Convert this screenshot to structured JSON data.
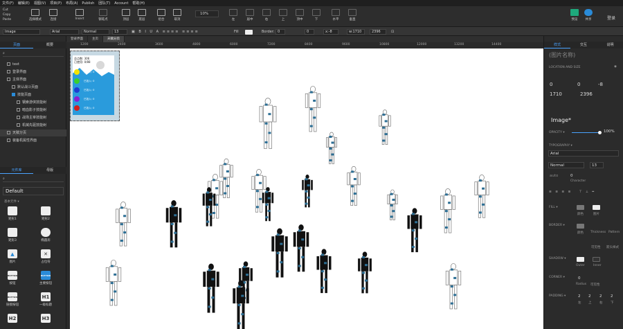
{
  "menu": [
    "文件(F)",
    "编辑(E)",
    "视图(V)",
    "项目(P)",
    "布局(A)",
    "Publish",
    "团队(T)",
    "Account",
    "帮助(H)"
  ],
  "mini_actions": [
    "Cut",
    "Copy",
    "Paste"
  ],
  "toolbar": {
    "select_mode": "选择模式",
    "connect": "连接",
    "insert": "Insert",
    "point": "钢笔点",
    "top": "顶层",
    "bottom": "底层",
    "combine": "组合",
    "uncombine": "取消",
    "zoom": "10%",
    "left": "左",
    "center": "居中",
    "right": "右",
    "up": "上",
    "middle": "顶中",
    "down": "下",
    "horizontal": "水平",
    "vertical": "垂直",
    "preview": "预览",
    "share": "共享",
    "login": "登录"
  },
  "propbar": {
    "type": "Image",
    "font": "Arial",
    "weight": "Normal",
    "size": "13",
    "fill": "Fill",
    "border_label": "Border:",
    "border": "0",
    "border2": "0",
    "x": "x:-8",
    "y": "y:-8",
    "w": "w:1710",
    "h": "2396",
    "ico_auto": "auto"
  },
  "left": {
    "tabs": [
      "页面",
      "概要"
    ],
    "pages": [
      {
        "label": "text",
        "indent": 0
      },
      {
        "label": "登录界面",
        "indent": 0
      },
      {
        "label": "主体界面",
        "indent": 0
      },
      {
        "label": "默认战斗页面",
        "indent": 1
      },
      {
        "label": "技能页面",
        "indent": 1
      },
      {
        "label": "钢索游侠技能树",
        "indent": 2
      },
      {
        "label": "暗血影子技能树",
        "indent": 2
      },
      {
        "label": "战场主宰技能树",
        "indent": 2
      },
      {
        "label": "机械先驱技能树",
        "indent": 2
      },
      {
        "label": "天赋分页",
        "indent": 0
      },
      {
        "label": "装备机属性界面",
        "indent": 0
      }
    ],
    "lib_tabs": [
      "元件库",
      "母版"
    ],
    "library": "Default",
    "section": "基本元件 ▾",
    "widgets": [
      {
        "label": "矩形1",
        "glyph": ""
      },
      {
        "label": "矩形2",
        "glyph": ""
      },
      {
        "label": "矩形3",
        "glyph": ""
      },
      {
        "label": "椭圆形",
        "glyph": ""
      },
      {
        "label": "图片",
        "glyph": "▲"
      },
      {
        "label": "占位符",
        "glyph": "✕"
      },
      {
        "label": "按钮",
        "glyph": "BUTTON"
      },
      {
        "label": "主要按钮",
        "glyph": "BUTTON"
      },
      {
        "label": "链接按钮",
        "glyph": "BUTTON"
      },
      {
        "label": "一级标题",
        "glyph": "H1"
      },
      {
        "label": "",
        "glyph": "H2"
      },
      {
        "label": "",
        "glyph": "H3"
      }
    ]
  },
  "doc_tabs": [
    "登录界面",
    "主页",
    "天赋分页"
  ],
  "ruler": [
    "1200",
    "2400",
    "3600",
    "4800",
    "6000",
    "7200",
    "8400",
    "9600",
    "10800",
    "12000",
    "13200",
    "14400"
  ],
  "minimap": {
    "title": "总点数: 306",
    "sub": "已使用: 0/88",
    "legend": [
      {
        "color": "#f5e400",
        "text": "已投入: 0"
      },
      {
        "color": "#3ccf2a",
        "text": "已投入: 0"
      },
      {
        "color": "#1f3bd1",
        "text": "已投入: 0"
      },
      {
        "color": "#8a1fd1",
        "text": "已投入: 0"
      },
      {
        "color": "#d11f1f",
        "text": "已投入: 0"
      }
    ]
  },
  "right": {
    "tabs": [
      "样式",
      "交互",
      "说明"
    ],
    "name_placeholder": "(图片名称)",
    "location": "LOCATION AND SIZE",
    "x": "0",
    "y": "0",
    "rot": "-8",
    "rot2": "-8",
    "w": "1710",
    "h": "2396",
    "element": "Image*",
    "opacity_label": "OPACITY ▾",
    "opacity": "100%",
    "typography": "TYPOGRAPHY ▾",
    "font": "Arial",
    "weight": "Normal",
    "size": "13",
    "auto": "auto",
    "char": "0",
    "char_label": "Character",
    "fill": "FILL ▾",
    "fill_a": "颜色",
    "fill_b": "图片",
    "border": "BORDER ▾",
    "border_a": "颜色",
    "border_b": "Thickness",
    "border_c": "Pattern",
    "border_d": "可见性",
    "border_e": "箭头样式",
    "shadow": "SHADOW ▾",
    "shadow_a": "Outer",
    "shadow_b": "Inner",
    "corner": "CORNER ▾",
    "radius": "0",
    "radius_label": "Radius",
    "vis": "可见性",
    "padding": "PADDING ▾",
    "pads": [
      "2",
      "2",
      "2",
      "2"
    ],
    "pad_labels": [
      "左",
      "上",
      "右",
      "下"
    ]
  }
}
